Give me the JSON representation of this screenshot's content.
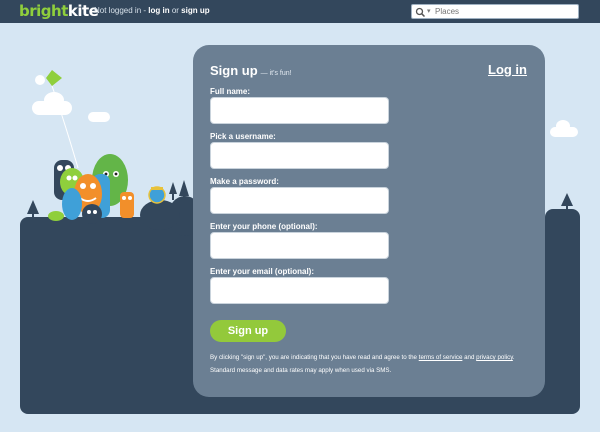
{
  "logo": {
    "part1": "bright",
    "part2": "kite"
  },
  "session": {
    "status": "Not logged in - ",
    "login_link": "log in",
    "or": " or ",
    "signup_link": "sign up"
  },
  "search": {
    "placeholder": "Places",
    "icon": "search-icon"
  },
  "signup": {
    "title": "Sign up",
    "subtitle": "— it's fun!",
    "login_link": "Log in",
    "fields": [
      {
        "label": "Full name:",
        "value": ""
      },
      {
        "label": "Pick a username:",
        "value": ""
      },
      {
        "label": "Make a password:",
        "value": ""
      },
      {
        "label": "Enter your phone (optional):",
        "value": ""
      },
      {
        "label": "Enter your email (optional):",
        "value": ""
      }
    ],
    "button_label": "Sign up",
    "legal_prefix": "By clicking \"sign up\", you are indicating that you have read and agree to the ",
    "terms_link": "terms of service",
    "legal_and": " and ",
    "privacy_link": "privacy policy",
    "legal_suffix": ".",
    "sms_note": "Standard message and data rates may apply when used via SMS."
  },
  "colors": {
    "topbar": "#33475c",
    "background": "#d6e6f3",
    "panel": "#6b7f93",
    "accent_green": "#93c93b",
    "logo_green": "#8fcf3c"
  }
}
